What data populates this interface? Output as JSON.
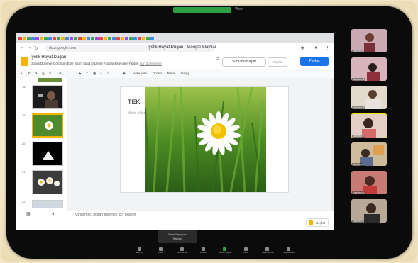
{
  "zoom": {
    "view_label": "View"
  },
  "browser": {
    "url": "docs.google.com",
    "title": "İyelik Hayat Dugan - Google Slaytlar"
  },
  "slides": {
    "doc_name": "İyelik Hayat Dugan",
    "menu": [
      "Dosya",
      "Düzenle",
      "Görünüm",
      "Ekle",
      "Biçim",
      "Slayt",
      "Düzenle",
      "Araçlar",
      "Eklentiler",
      "Yardım",
      "Son düzenleme"
    ],
    "present_label": "Sunumu Başlat",
    "slideshow_label": "Slaytlar",
    "share_label": "Paylaş",
    "toolbar": {
      "layout": "Arka plan",
      "theme": "Düzen",
      "transition": "Tema",
      "more": "Geçiş"
    },
    "thumb_numbers": [
      "18",
      "19",
      "20",
      "21",
      "22"
    ],
    "slide_title": "TEK",
    "slide_subtitle": "Metin eklemek için tıklayın",
    "notes_placeholder": "Konuşmacı notları eklemek için tıklayın",
    "explore_label": "Keşfet"
  },
  "toast": {
    "line1": "Ekran Paylaşımı",
    "line2": "Başladı"
  },
  "bottom_bar": [
    "Sesi aç",
    "Video",
    "Katılımcılar",
    "Sohbet",
    "Ekran paylaş",
    "Kayıt",
    "Reaksiyonlar",
    "Uygulamalar"
  ],
  "participants": [
    {
      "name": "Katılımcı 1",
      "bg": "#9a6f7c"
    },
    {
      "name": "Katılımcı 2",
      "bg": "#b77a86"
    },
    {
      "name": "Katılımcı 3",
      "bg": "#c8b6a0"
    },
    {
      "name": "Katılımcı 4",
      "bg": "#c79a8c"
    },
    {
      "name": "Katılımcı 5",
      "bg": "#a78d6e"
    },
    {
      "name": "Katılımcı 6",
      "bg": "#b65a52"
    },
    {
      "name": "Katılımcı 7",
      "bg": "#8e7b6a"
    }
  ]
}
